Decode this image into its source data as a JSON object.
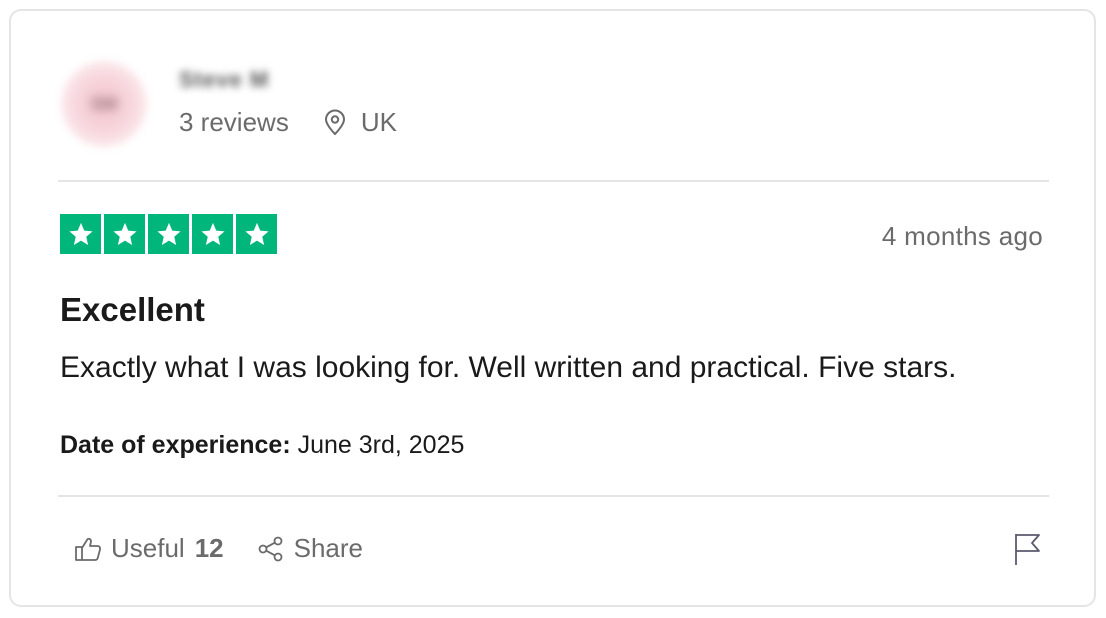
{
  "reviewer": {
    "initials": "SM",
    "name": "Steve M",
    "reviews_count": "3 reviews",
    "location": "UK"
  },
  "review": {
    "rating": 5,
    "rating_max": 5,
    "time_ago": "4 months ago",
    "title": "Excellent",
    "body": "Exactly what I was looking for. Well written and practical. Five stars.",
    "date_label": "Date of experience:",
    "date_value": "June 3rd, 2025"
  },
  "actions": {
    "useful_label": "Useful",
    "useful_count": "12",
    "share_label": "Share"
  },
  "icons": {
    "location": "location-pin-icon",
    "useful": "thumbs-up-icon",
    "share": "share-icon",
    "flag": "flag-icon",
    "star": "star-icon"
  },
  "colors": {
    "star_green": "#00b67a",
    "text_primary": "#1a1a1a",
    "text_muted": "#6b6b6b",
    "border": "#e5e5e5"
  }
}
